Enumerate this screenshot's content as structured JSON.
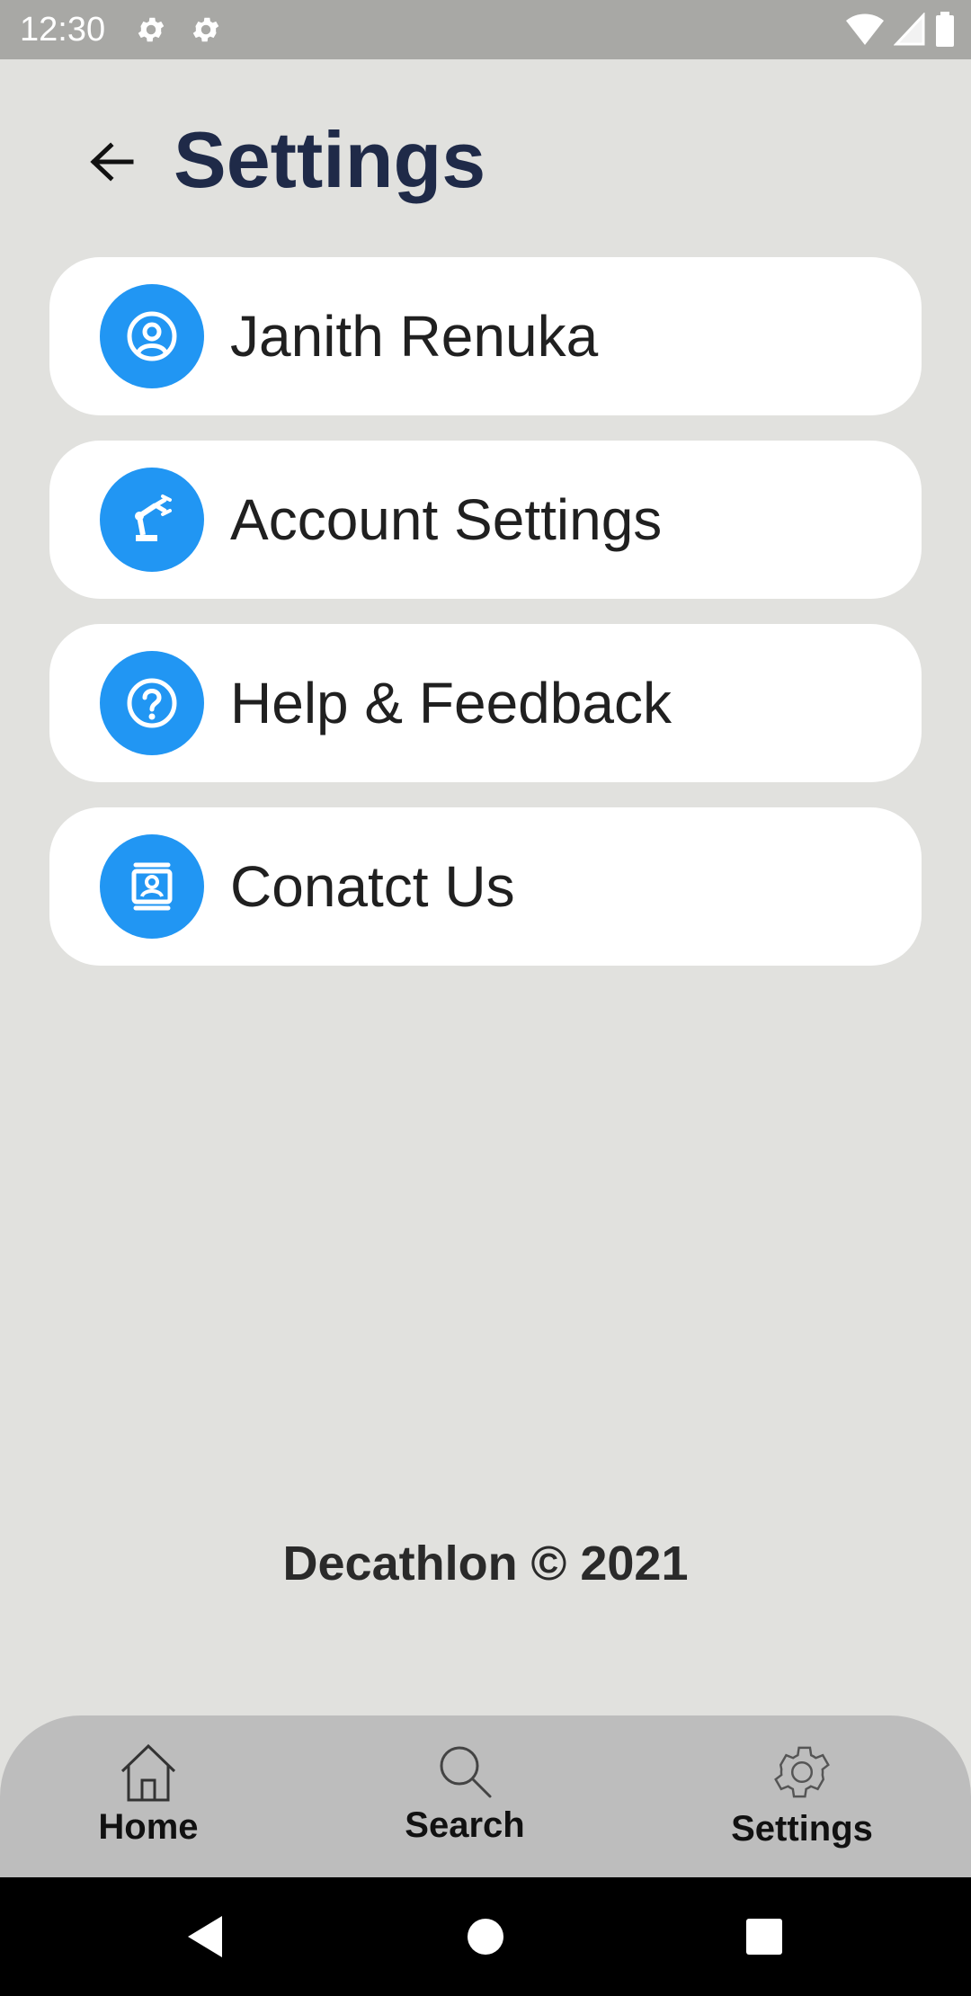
{
  "status_bar": {
    "time": "12:30",
    "icons": [
      "settings-gear-icon",
      "settings-gear-icon",
      "wifi-icon",
      "signal-icon",
      "battery-icon"
    ]
  },
  "header": {
    "back_icon": "arrow-left-icon",
    "title": "Settings"
  },
  "menu": {
    "items": [
      {
        "icon": "user-circle-icon",
        "label": "Janith Renuka"
      },
      {
        "icon": "robot-arm-icon",
        "label": "Account Settings"
      },
      {
        "icon": "help-circle-icon",
        "label": "Help & Feedback"
      },
      {
        "icon": "contact-card-icon",
        "label": "Conatct Us"
      }
    ]
  },
  "footer": {
    "text": "Decathlon © 2021"
  },
  "bottom_nav": {
    "items": [
      {
        "icon": "home-icon",
        "label": "Home"
      },
      {
        "icon": "search-icon",
        "label": "Search"
      },
      {
        "icon": "gear-icon",
        "label": "Settings"
      }
    ]
  },
  "system_nav": {
    "buttons": [
      "back-triangle-icon",
      "home-circle-icon",
      "recents-square-icon"
    ]
  },
  "colors": {
    "background": "#e1e1de",
    "status_bar": "#a8a8a5",
    "title": "#1f2a48",
    "accent": "#2196f3",
    "card": "#ffffff",
    "bottom_nav": "#bdbdbd",
    "system_nav": "#000000"
  }
}
